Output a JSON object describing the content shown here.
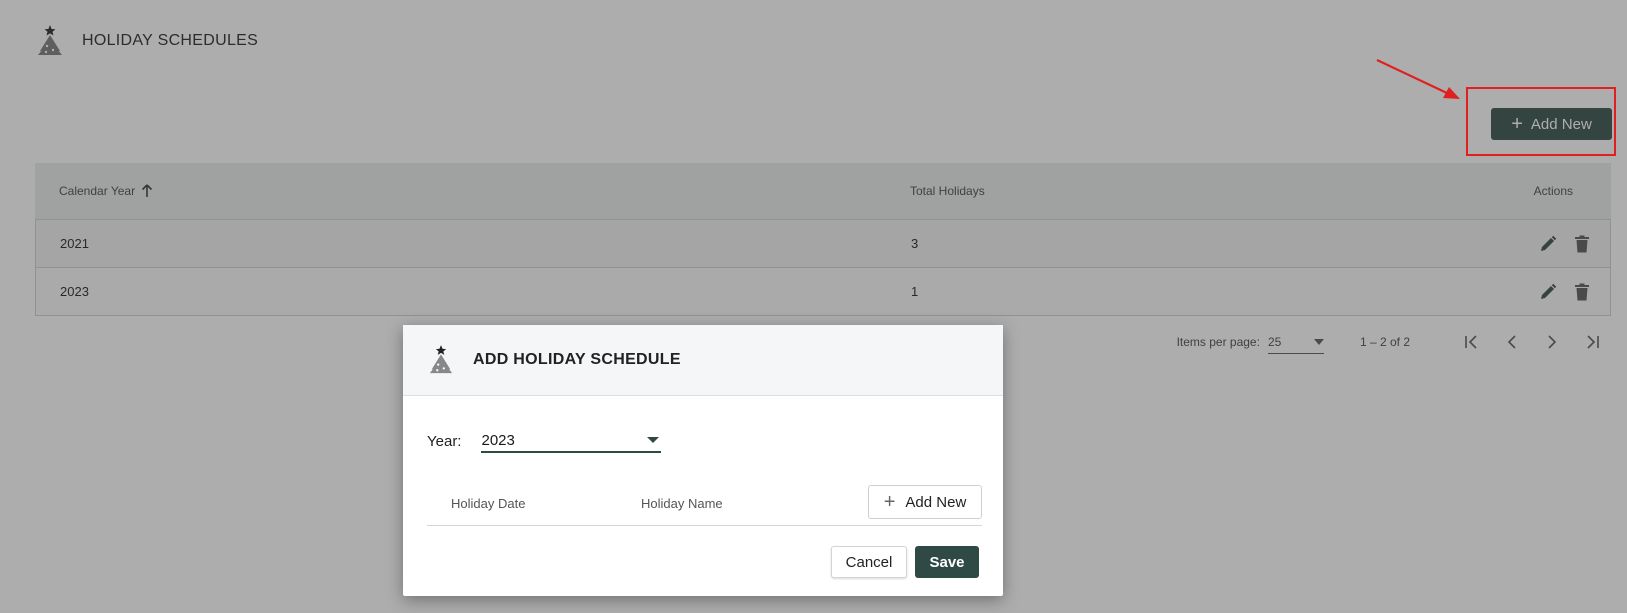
{
  "header": {
    "title": "HOLIDAY SCHEDULES",
    "icon": "christmas-tree-icon"
  },
  "toolbar": {
    "add_new_label": "Add New",
    "add_icon": "plus-icon"
  },
  "table": {
    "columns": {
      "calendar_year": "Calendar Year",
      "total_holidays": "Total Holidays",
      "actions": "Actions"
    },
    "sort": {
      "column": "Calendar Year",
      "direction": "ascending"
    },
    "rows": [
      {
        "year": "2021",
        "total": "3"
      },
      {
        "year": "2023",
        "total": "1"
      }
    ]
  },
  "pager": {
    "items_per_page_label": "Items per page:",
    "items_per_page_value": "25",
    "range": "1 – 2 of 2"
  },
  "dialog": {
    "title": "ADD HOLIDAY SCHEDULE",
    "year_label": "Year:",
    "year_value": "2023",
    "columns": {
      "holiday_date": "Holiday Date",
      "holiday_name": "Holiday Name"
    },
    "add_new_label": "Add New",
    "cancel_label": "Cancel",
    "save_label": "Save"
  },
  "colors": {
    "primary": "#2f4a44",
    "annotation": "#e02020",
    "overlay": "rgba(60,60,60,0.42)"
  }
}
